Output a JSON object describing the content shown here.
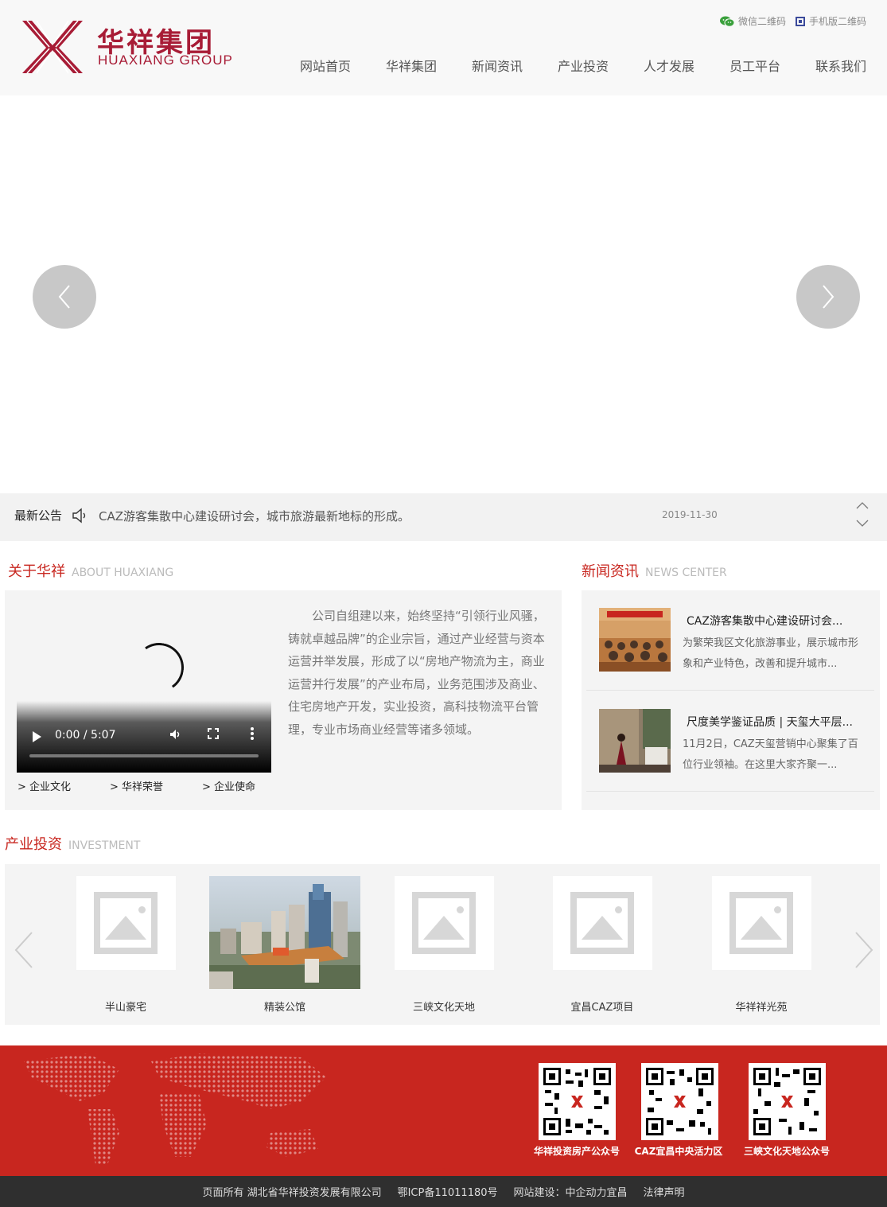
{
  "brand": {
    "name_cn": "华祥集团",
    "name_en": "HUAXIANG GROUP",
    "color": "#a81c36"
  },
  "topbar": {
    "wechat_qr": "微信二维码",
    "mobile_qr": "手机版二维码"
  },
  "nav": [
    "网站首页",
    "华祥集团",
    "新闻资讯",
    "产业投资",
    "人才发展",
    "员工平台",
    "联系我们"
  ],
  "notice": {
    "title": "最新公告",
    "text": "CAZ游客集散中心建设研讨会，城市旅游最新地标的形成。",
    "date": "2019-11-30"
  },
  "about": {
    "title": "关于华祥",
    "title_en": "ABOUT HUAXIANG",
    "video_time": "0:00 / 5:07",
    "text": "公司自组建以来，始终坚持“引领行业风骚，铸就卓越品牌”的企业宗旨，通过产业经营与资本运营并举发展，形成了以“房地产物流为主，商业运营并行发展”的产业布局，业务范围涉及商业、住宅房地产开发，实业投资，高科技物流平台管理，专业市场商业经营等诸多领域。",
    "links": [
      "> 企业文化",
      "> 华祥荣誉",
      "> 企业使命"
    ]
  },
  "news": {
    "title": "新闻资讯",
    "title_en": "NEWS CENTER",
    "items": [
      {
        "title": "CAZ游客集散中心建设研讨会...",
        "desc": "为繁荣我区文化旅游事业，展示城市形象和产业特色，改善和提升城市..."
      },
      {
        "title": "尺度美学鉴证品质 | 天玺大平层...",
        "desc": "11月2日，CAZ天玺营销中心聚集了百位行业领袖。在这里大家齐聚一..."
      }
    ]
  },
  "investment": {
    "title": "产业投资",
    "title_en": "INVESTMENT",
    "items": [
      "半山豪宅",
      "精装公馆",
      "三峡文化天地",
      "宜昌CAZ项目",
      "华祥祥光苑"
    ]
  },
  "footer": {
    "qr_labels": [
      "华祥投资房产公众号",
      "CAZ宜昌中央活力区",
      "三峡文化天地公众号"
    ],
    "copyright": [
      "页面所有 湖北省华祥投资发展有限公司",
      "鄂ICP备11011180号",
      "网站建设：中企动力宜昌",
      "法律声明"
    ],
    "accent": "#c8261f"
  }
}
